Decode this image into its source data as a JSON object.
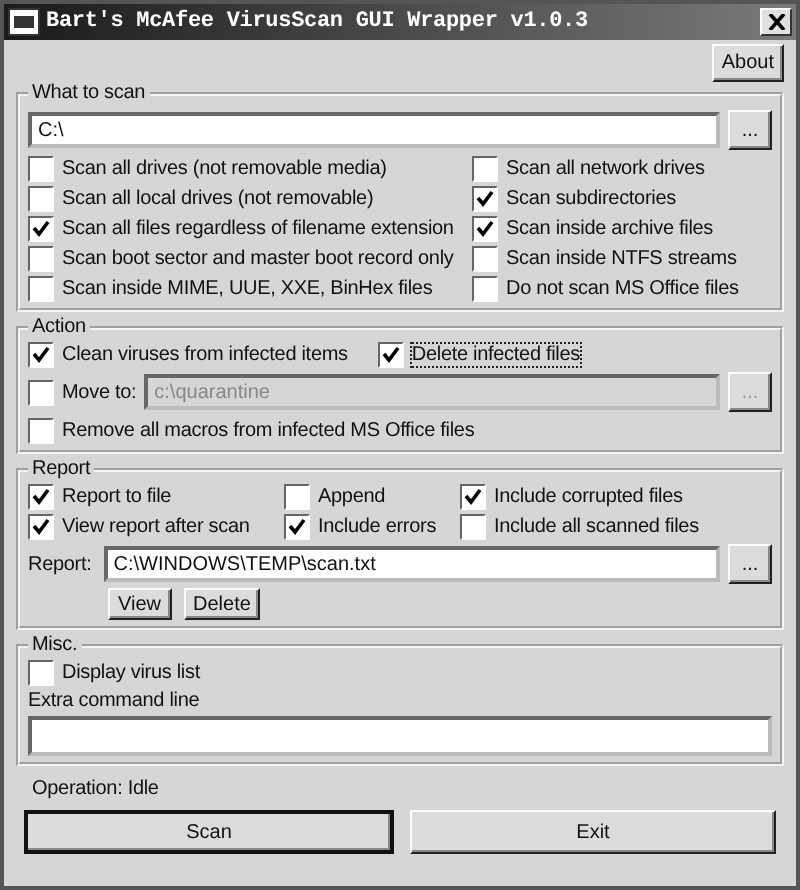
{
  "window": {
    "title": "Bart's McAfee VirusScan GUI Wrapper v1.0.3"
  },
  "about_button": "About",
  "what_to_scan": {
    "title": "What to scan",
    "path": "C:\\",
    "browse": "...",
    "options": [
      {
        "label": "Scan all drives (not removable media)",
        "checked": false
      },
      {
        "label": "Scan all network drives",
        "checked": false
      },
      {
        "label": "Scan all local drives (not removable)",
        "checked": false
      },
      {
        "label": "Scan subdirectories",
        "checked": true
      },
      {
        "label": "Scan all files regardless of filename extension",
        "checked": true
      },
      {
        "label": "Scan inside archive files",
        "checked": true
      },
      {
        "label": "Scan boot sector and master boot record only",
        "checked": false
      },
      {
        "label": "Scan inside NTFS streams",
        "checked": false
      },
      {
        "label": "Scan inside MIME, UUE, XXE, BinHex files",
        "checked": false
      },
      {
        "label": "Do not scan MS Office files",
        "checked": false
      }
    ]
  },
  "action": {
    "title": "Action",
    "clean": {
      "label": "Clean viruses from infected items",
      "checked": true,
      "focused": false
    },
    "delete": {
      "label": "Delete infected files",
      "checked": true,
      "focused": true
    },
    "move_to": {
      "label": "Move to:",
      "checked": false,
      "value": "c:\\quarantine",
      "disabled": true,
      "browse": "..."
    },
    "remove_macros": {
      "label": "Remove all macros from infected MS Office files",
      "checked": false
    }
  },
  "report": {
    "title": "Report",
    "options": [
      {
        "label": "Report to file",
        "checked": true
      },
      {
        "label": "Append",
        "checked": false
      },
      {
        "label": "Include corrupted files",
        "checked": true
      },
      {
        "label": "View report after scan",
        "checked": true
      },
      {
        "label": "Include errors",
        "checked": true
      },
      {
        "label": "Include all scanned files",
        "checked": false
      }
    ],
    "file_label": "Report:",
    "file": "C:\\WINDOWS\\TEMP\\scan.txt",
    "browse": "...",
    "buttons": [
      "View",
      "Delete"
    ]
  },
  "misc": {
    "title": "Misc.",
    "display_virus_list": {
      "label": "Display virus list",
      "checked": false
    },
    "extra_label": "Extra command line"
  },
  "status": "Operation: Idle",
  "buttons": [
    "Scan",
    "Exit"
  ]
}
